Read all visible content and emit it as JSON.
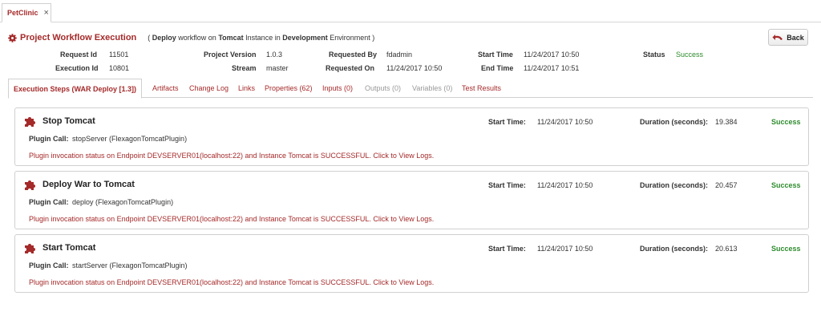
{
  "window": {
    "tab_label": "PetClinic",
    "close_glyph": "×"
  },
  "header": {
    "title": "Project Workflow Execution",
    "sub_open": "( ",
    "sub_workflow": "Deploy",
    "sub_t1": " workflow on ",
    "sub_instance": "Tomcat",
    "sub_t2": " Instance in ",
    "sub_env": "Development",
    "sub_t3": " Environment )",
    "back_label": "Back"
  },
  "info": {
    "request_id_label": "Request Id",
    "request_id": "11501",
    "execution_id_label": "Execution Id",
    "execution_id": "10801",
    "project_version_label": "Project Version",
    "project_version": "1.0.3",
    "stream_label": "Stream",
    "stream": "master",
    "requested_by_label": "Requested By",
    "requested_by": "fdadmin",
    "requested_on_label": "Requested On",
    "requested_on": "11/24/2017 10:50",
    "start_time_label": "Start Time",
    "start_time": "11/24/2017 10:50",
    "end_time_label": "End Time",
    "end_time": "11/24/2017 10:51",
    "status_label": "Status",
    "status": "Success"
  },
  "tabs": [
    {
      "label": "Execution Steps (WAR Deploy [1.3])"
    },
    {
      "label": "Artifacts"
    },
    {
      "label": "Change Log"
    },
    {
      "label": "Links"
    },
    {
      "label": "Properties (62)"
    },
    {
      "label": "Inputs (0)"
    },
    {
      "label": "Outputs (0)"
    },
    {
      "label": "Variables (0)"
    },
    {
      "label": "Test Results"
    }
  ],
  "step_labels": {
    "start_time": "Start Time:",
    "duration": "Duration (seconds):",
    "plugin_call": "Plugin Call:"
  },
  "steps": [
    {
      "name": "Stop Tomcat",
      "start_time": "11/24/2017 10:50",
      "duration": "19.384",
      "status": "Success",
      "plugin_call": "stopServer (FlexagonTomcatPlugin)",
      "message": "Plugin invocation status on Endpoint DEVSERVER01(localhost:22) and Instance Tomcat is SUCCESSFUL. Click to View Logs."
    },
    {
      "name": "Deploy War to Tomcat",
      "start_time": "11/24/2017 10:50",
      "duration": "20.457",
      "status": "Success",
      "plugin_call": "deploy (FlexagonTomcatPlugin)",
      "message": "Plugin invocation status on Endpoint DEVSERVER01(localhost:22) and Instance Tomcat is SUCCESSFUL. Click to View Logs."
    },
    {
      "name": "Start Tomcat",
      "start_time": "11/24/2017 10:50",
      "duration": "20.613",
      "status": "Success",
      "plugin_call": "startServer (FlexagonTomcatPlugin)",
      "message": "Plugin invocation status on Endpoint DEVSERVER01(localhost:22) and Instance Tomcat is SUCCESSFUL. Click to View Logs."
    }
  ],
  "colors": {
    "accent": "#a52a2a",
    "success": "#2e8b2e"
  },
  "icons": {
    "header": "gear-icon",
    "back": "undo-arrow-icon",
    "step": "puzzle-piece-icon",
    "tab_close": "close-icon"
  }
}
